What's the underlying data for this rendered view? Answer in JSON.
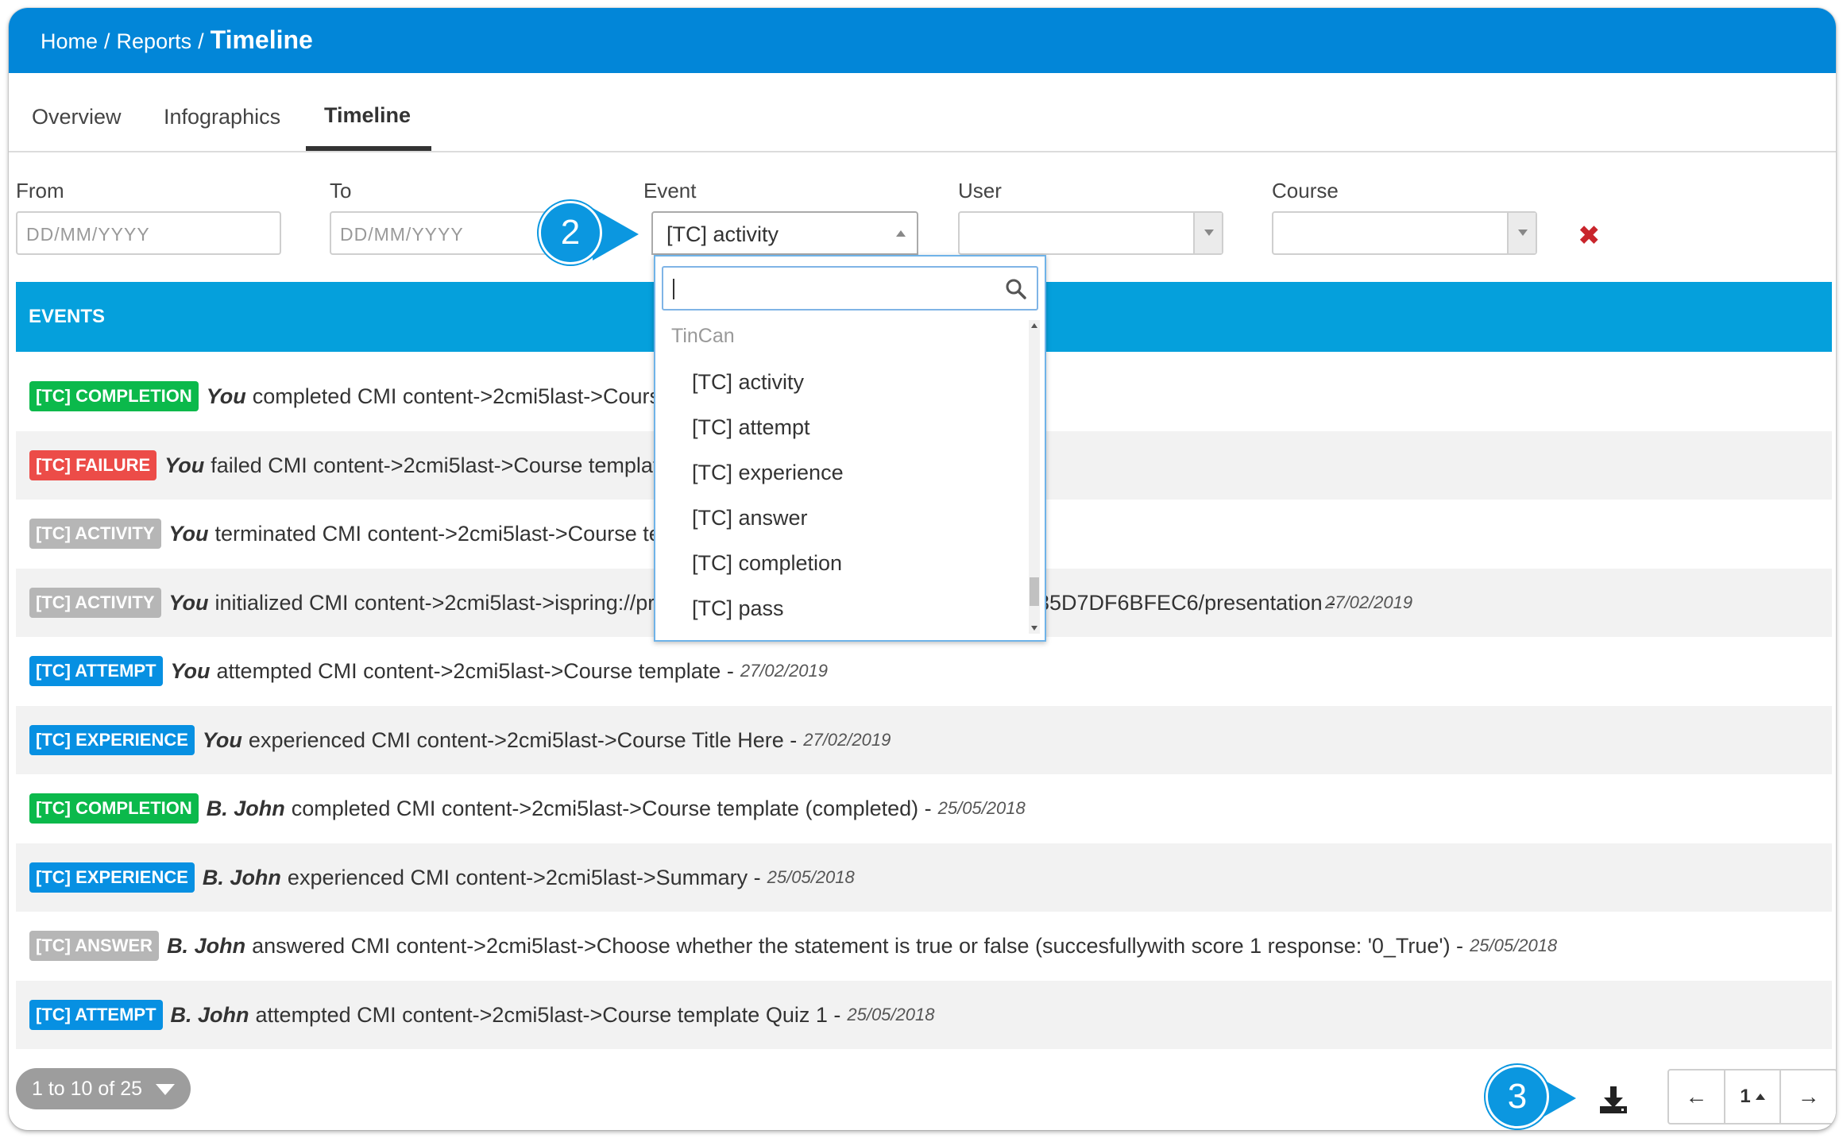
{
  "breadcrumb": {
    "home": "Home",
    "sep1": "/",
    "reports": "Reports",
    "sep2": "/",
    "current": "Timeline"
  },
  "tabs": [
    {
      "label": "Overview",
      "active": false
    },
    {
      "label": "Infographics",
      "active": false
    },
    {
      "label": "Timeline",
      "active": true
    }
  ],
  "filters": {
    "from": {
      "label": "From",
      "placeholder": "DD/MM/YYYY"
    },
    "to": {
      "label": "To",
      "placeholder": "DD/MM/YYYY"
    },
    "event": {
      "label": "Event",
      "value": "[TC] activity"
    },
    "user": {
      "label": "User",
      "value": ""
    },
    "course": {
      "label": "Course",
      "value": ""
    },
    "clear_icon": "close-icon"
  },
  "events_header": "EVENTS",
  "events": [
    {
      "badge": "[TC] COMPLETION",
      "color": "#0bb94b",
      "actor": "You",
      "text": "completed CMI content->2cmi5last->Cours",
      "date": ""
    },
    {
      "badge": "[TC] FAILURE",
      "color": "#ec4c48",
      "actor": "You",
      "text": "failed CMI content->2cmi5last->Course template",
      "date": ""
    },
    {
      "badge": "[TC] ACTIVITY",
      "color": "#b6b6b6",
      "actor": "You",
      "text": "terminated CMI content->2cmi5last->Course te",
      "date": ""
    },
    {
      "badge": "[TC] ACTIVITY",
      "color": "#b6b6b6",
      "actor": "You",
      "text": "initialized CMI content->2cmi5last->ispring://pr",
      "tail": "35D7DF6BFEC6/presentation -",
      "date": "27/02/2019"
    },
    {
      "badge": "[TC] ATTEMPT",
      "color": "#0790e2",
      "actor": "You",
      "text": "attempted CMI content->2cmi5last->Course template -",
      "date": "27/02/2019"
    },
    {
      "badge": "[TC] EXPERIENCE",
      "color": "#0790e2",
      "actor": "You",
      "text": "experienced CMI content->2cmi5last->Course Title Here -",
      "date": "27/02/2019"
    },
    {
      "badge": "[TC] COMPLETION",
      "color": "#0bb94b",
      "actor": "B. John",
      "text": "completed CMI content->2cmi5last->Course template (completed) -",
      "date": "25/05/2018"
    },
    {
      "badge": "[TC] EXPERIENCE",
      "color": "#0790e2",
      "actor": "B. John",
      "text": "experienced CMI content->2cmi5last->Summary -",
      "date": "25/05/2018"
    },
    {
      "badge": "[TC] ANSWER",
      "color": "#b6b6b6",
      "actor": "B. John",
      "text": "answered CMI content->2cmi5last->Choose whether the statement is true or false (succesfullywith score 1 response: '0_True') -",
      "date": "25/05/2018"
    },
    {
      "badge": "[TC] ATTEMPT",
      "color": "#0790e2",
      "actor": "B. John",
      "text": "attempted CMI content->2cmi5last->Course template Quiz 1 -",
      "date": "25/05/2018"
    }
  ],
  "dropdown": {
    "search_value": "",
    "group": "TinCan",
    "items": [
      "[TC] activity",
      "[TC] attempt",
      "[TC] experience",
      "[TC] answer",
      "[TC] completion",
      "[TC] pass"
    ]
  },
  "callouts": {
    "event": "2",
    "download": "3"
  },
  "pagination": {
    "info": "1 to 10 of 25",
    "prev": "←",
    "current": "1",
    "next": "→"
  },
  "icons": {
    "search": "search-icon",
    "download": "download-icon"
  }
}
